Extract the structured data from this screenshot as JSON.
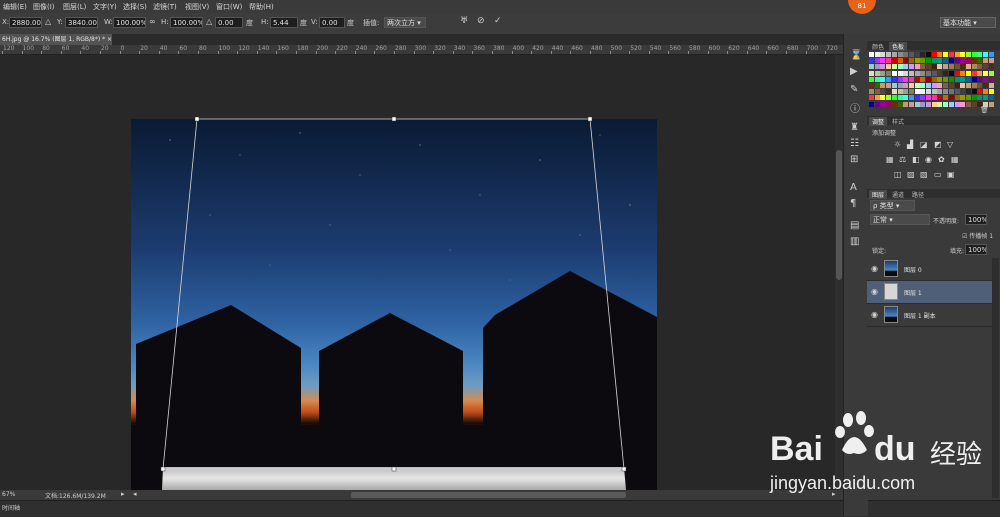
{
  "menu": [
    "编辑(E)",
    "图像(I)",
    "图层(L)",
    "文字(Y)",
    "选择(S)",
    "滤镜(T)",
    "视图(V)",
    "窗口(W)",
    "帮助(H)"
  ],
  "options": {
    "x_label": "X:",
    "x_value": "2880.00 像",
    "y_label": "Y:",
    "y_value": "3840.00 像",
    "w_label": "W:",
    "w_value": "100.00%",
    "h_label": "H:",
    "h_value": "100.00%",
    "angle_value": "0.00",
    "angle_unit": "度",
    "hskew_label": "H:",
    "hskew_value": "5.44",
    "hskew_unit": "度",
    "vskew_label": "V:",
    "vskew_value": "0.00",
    "vskew_unit": "度",
    "interp_label": "插值:",
    "interp_value": "两次立方",
    "workspace_value": "基本功能"
  },
  "doc_tab": "6H.jpg @ 16.7% (图层 1, RGB/8*) * ×",
  "ruler_ticks": [
    "120",
    "100",
    "80",
    "60",
    "40",
    "20",
    "0",
    "20",
    "40",
    "60",
    "80",
    "100",
    "120",
    "140",
    "160",
    "180",
    "200",
    "220",
    "240",
    "260",
    "280",
    "300",
    "320",
    "340",
    "360",
    "380",
    "400",
    "420",
    "440",
    "460",
    "480",
    "500",
    "520",
    "540",
    "560",
    "580",
    "600",
    "620",
    "640",
    "660",
    "680",
    "700",
    "720",
    "740"
  ],
  "status": {
    "zoom": "67%",
    "doc": "文档:126.6M/139.2M"
  },
  "timeline_label": "时间轴",
  "panels": {
    "color_tabs": [
      "颜色",
      "色板"
    ],
    "adjust_tabs": [
      "调整",
      "样式"
    ],
    "adjust_title": "添加调整",
    "layer_tabs": [
      "图层",
      "通道",
      "路径"
    ],
    "kind_label": "ρ 类型",
    "blend_mode": "正常",
    "opacity_label": "不透明度:",
    "opacity_value": "100%",
    "lock_label": "锁定:",
    "fill_label": "填充:",
    "fill_value": "100%",
    "propagate_label": "传播帧 1",
    "layers": [
      {
        "name": "图层 0",
        "selected": false
      },
      {
        "name": "图层 1",
        "selected": true
      },
      {
        "name": "图层 1 副本",
        "selected": false
      }
    ]
  },
  "swatch_colors": [
    "#ffffff",
    "#f2f2f2",
    "#d9d9d9",
    "#bfbfbf",
    "#a6a6a6",
    "#8c8c8c",
    "#737373",
    "#595959",
    "#404040",
    "#262626",
    "#0d0d0d",
    "#ff0000",
    "#ff8000",
    "#ffff00",
    "#ff3333",
    "#ff9933",
    "#ffff33",
    "#99ff33",
    "#33ff33",
    "#33ff99",
    "#33ffff",
    "#3399ff",
    "#3333ff",
    "#9933ff",
    "#ff33ff",
    "#ff3399",
    "#cc0000",
    "#cc6600",
    "#990000",
    "#996600",
    "#999900",
    "#669900",
    "#009900",
    "#009966",
    "#009999",
    "#006699",
    "#000099",
    "#660099",
    "#990099",
    "#990066",
    "#663300",
    "#336600",
    "#cc9966",
    "#cc9999",
    "#99cccc",
    "#9999cc",
    "#cc99cc",
    "#ffcc99",
    "#ccff99",
    "#99ffcc",
    "#99ccff",
    "#cc99ff",
    "#ff99cc",
    "#806040",
    "#604020",
    "#402010",
    "#e6c8a0",
    "#c8a078",
    "#a07850",
    "#785028",
    "#502810",
    "#d4b090",
    "#b08860",
    "#886040",
    "#604030",
    "#403020",
    "#e0e0c0",
    "#c0c0a0",
    "#a0a080",
    "#808060"
  ],
  "watermark": {
    "badge": "81",
    "brand": "Bai",
    "brand2": "du",
    "cn": "经验",
    "url": "jingyan.baidu.com"
  },
  "colors": {
    "accent": "#e8621a",
    "selected_layer": "#4f5f78"
  }
}
